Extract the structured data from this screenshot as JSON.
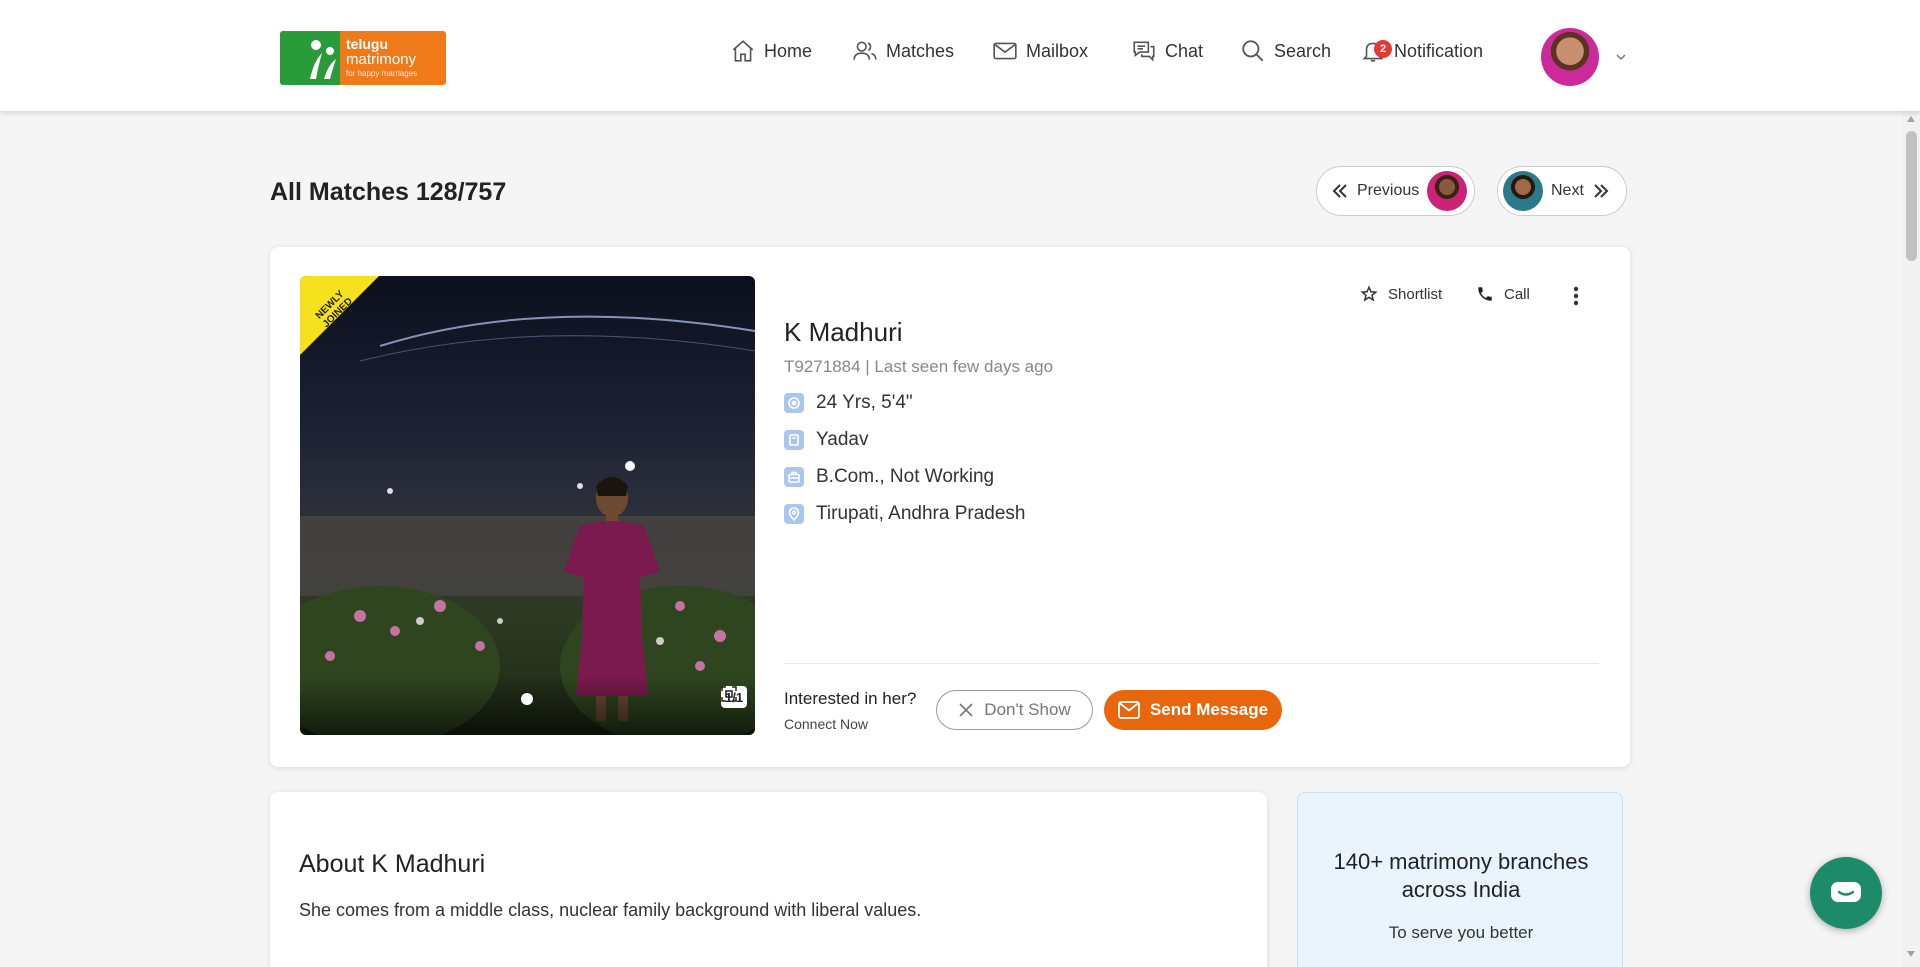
{
  "logo": {
    "line1": "telugu",
    "line2": "matrimony",
    "tagline": "for happy marriages"
  },
  "nav": {
    "home": "Home",
    "matches": "Matches",
    "mailbox": "Mailbox",
    "chat": "Chat",
    "search": "Search",
    "notification": "Notification",
    "notification_count": "2"
  },
  "page": {
    "title": "All Matches 128/757",
    "previous": "Previous",
    "next": "Next"
  },
  "profile": {
    "badge": "NEWLY JOINED",
    "photo_counter": "1/1",
    "name": "K Madhuri",
    "id_line": "T9271884 | Last seen few days ago",
    "age_height": "24 Yrs, 5'4\"",
    "caste": "Yadav",
    "education": "B.Com., Not Working",
    "location": "Tirupati, Andhra Pradesh",
    "shortlist": "Shortlist",
    "call": "Call"
  },
  "interest": {
    "question": "Interested in her?",
    "subtext": "Connect Now",
    "dont_show": "Don't Show",
    "send_message": "Send Message"
  },
  "about": {
    "title": "About K Madhuri",
    "text": "She comes from a middle class, nuclear family background with liberal values."
  },
  "branches": {
    "title": "140+ matrimony branches across India",
    "subtitle": "To serve you better"
  },
  "colors": {
    "accent": "#e8660c",
    "brand_green": "#2a9b3b",
    "chat_fab": "#1d8b6a",
    "badge": "#f6e11e"
  },
  "icons": [
    "home-icon",
    "users-icon",
    "mail-icon",
    "chat-icon",
    "search-icon",
    "bell-icon",
    "chevron-down-icon",
    "star-icon",
    "phone-icon",
    "more-vertical-icon",
    "close-icon",
    "chevron-double-left-icon",
    "chevron-double-right-icon",
    "expand-icon"
  ]
}
